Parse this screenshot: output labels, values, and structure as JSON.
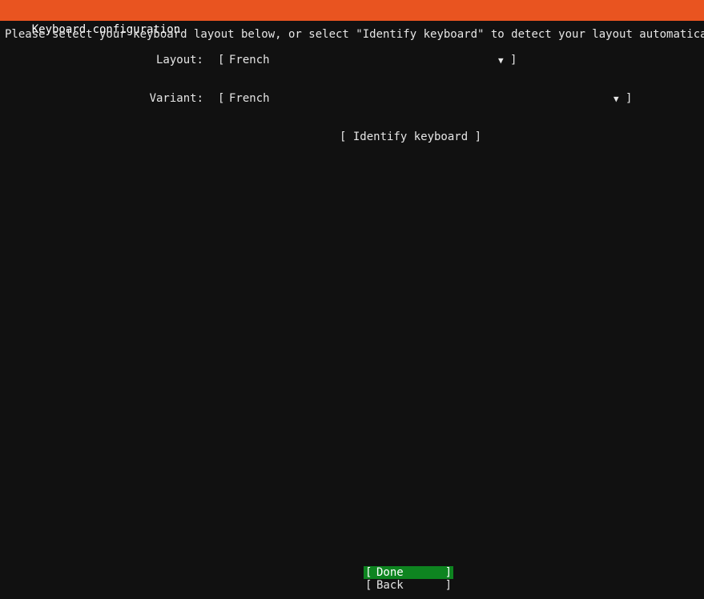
{
  "window": {
    "title": "Keyboard configuration"
  },
  "instruction": "Please select your keyboard layout below, or select \"Identify keyboard\" to detect your layout automatically.",
  "form": {
    "layout_label": "Layout:",
    "layout_value": "French",
    "variant_label": "Variant:",
    "variant_value": "French",
    "open_bracket": "[",
    "close_bracket": "]",
    "arrow_icon": "▼"
  },
  "identify_button": "[ Identify keyboard ]",
  "actions": {
    "done_label": "Done",
    "back_label": "Back",
    "open_bracket": "[",
    "close_bracket": "]"
  },
  "colors": {
    "title_bar": "#e95420",
    "background": "#111111",
    "focused_button": "#0e8420"
  }
}
